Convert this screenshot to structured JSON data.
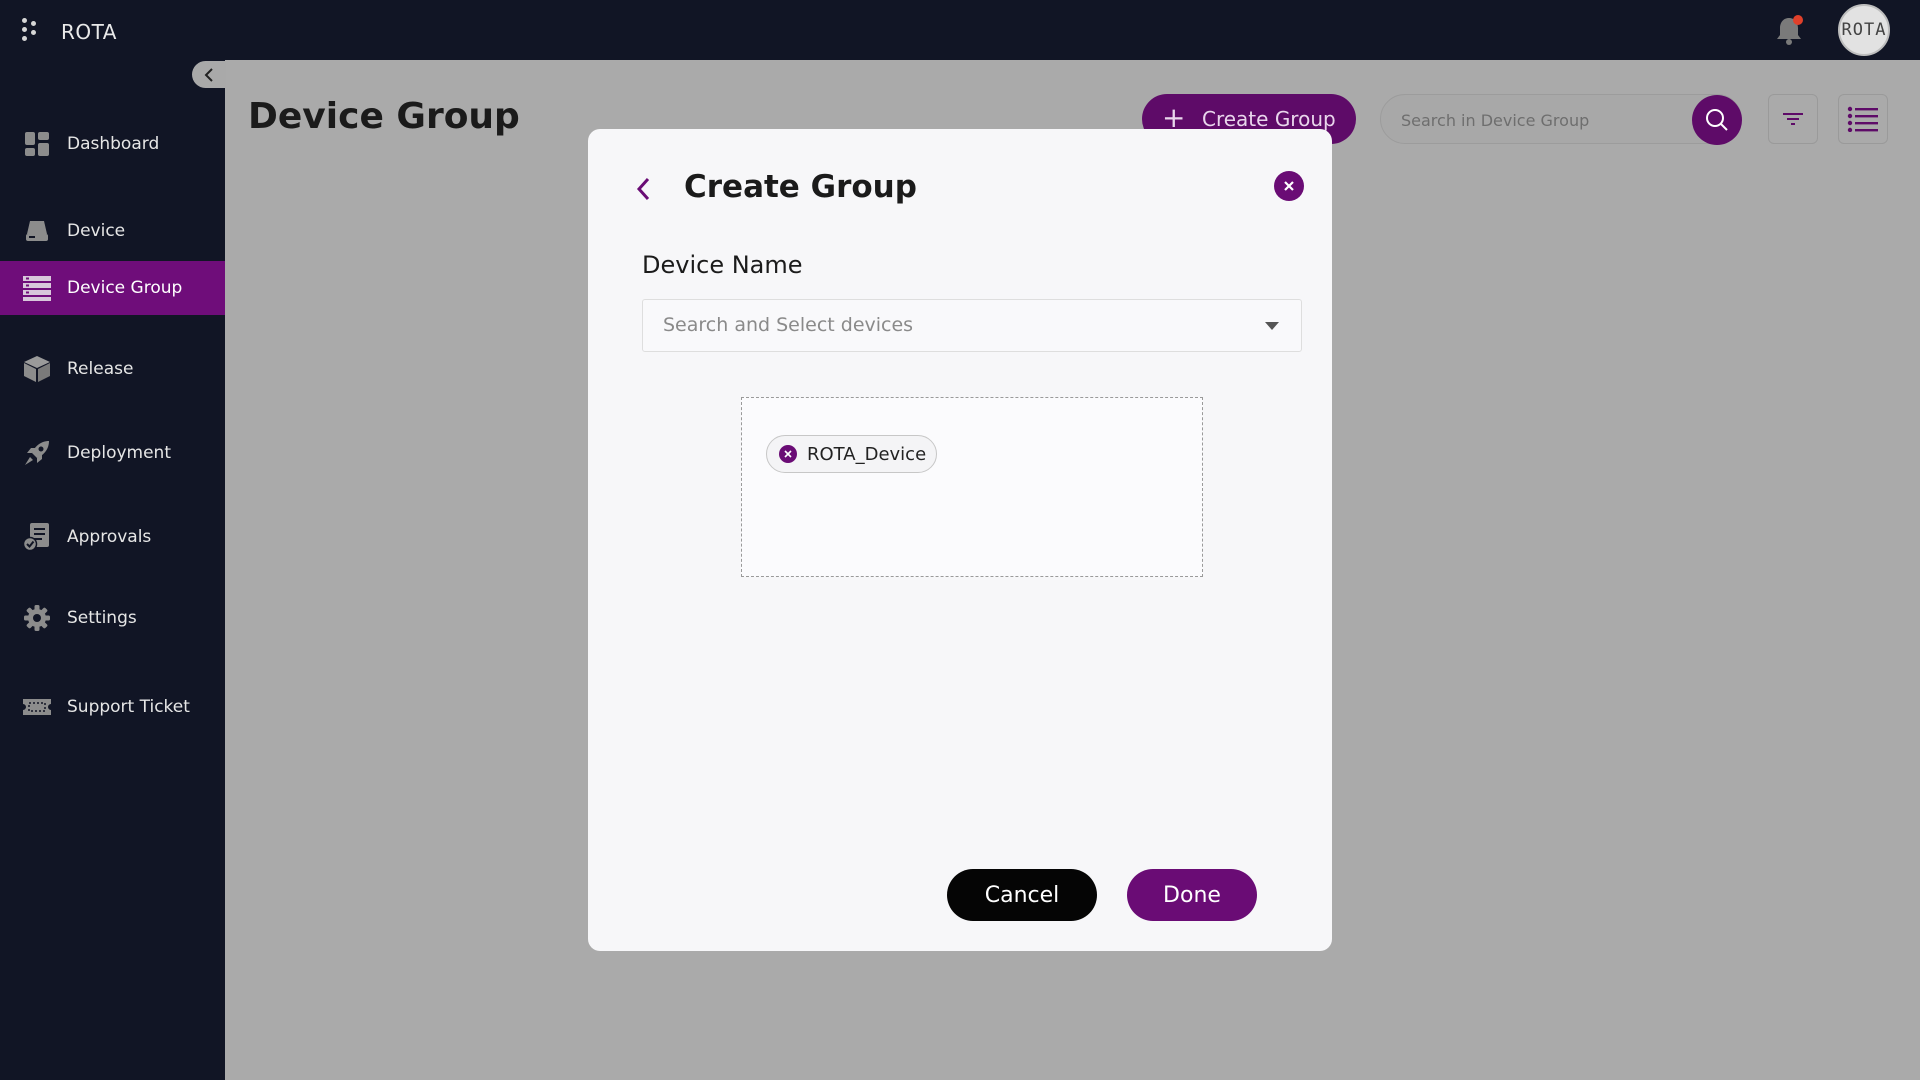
{
  "app": {
    "name": "ROTA",
    "avatar_text": "ROTA",
    "notification_icon": "bell-icon"
  },
  "sidebar": {
    "items": [
      {
        "label": "Dashboard",
        "icon": "dashboard-icon",
        "active": false
      },
      {
        "label": "Device",
        "icon": "device-icon",
        "active": false
      },
      {
        "label": "Device Group",
        "icon": "device-group-icon",
        "active": true
      },
      {
        "label": "Release",
        "icon": "box-icon",
        "active": false
      },
      {
        "label": "Deployment",
        "icon": "rocket-icon",
        "active": false
      },
      {
        "label": "Approvals",
        "icon": "approvals-icon",
        "active": false
      },
      {
        "label": "Settings",
        "icon": "gear-icon",
        "active": false
      },
      {
        "label": "Support Ticket",
        "icon": "ticket-icon",
        "active": false
      }
    ]
  },
  "header": {
    "title": "Device Group",
    "create_button": "Create Group",
    "search_placeholder": "Search in Device Group"
  },
  "modal": {
    "title": "Create Group",
    "field_label": "Device Name",
    "select_placeholder": "Search and Select devices",
    "chips": [
      "ROTA_Device"
    ],
    "cancel_label": "Cancel",
    "done_label": "Done"
  },
  "colors": {
    "accent": "#6a0c75",
    "sidebar_bg": "#111525",
    "overlay": "#aaaaaa"
  }
}
